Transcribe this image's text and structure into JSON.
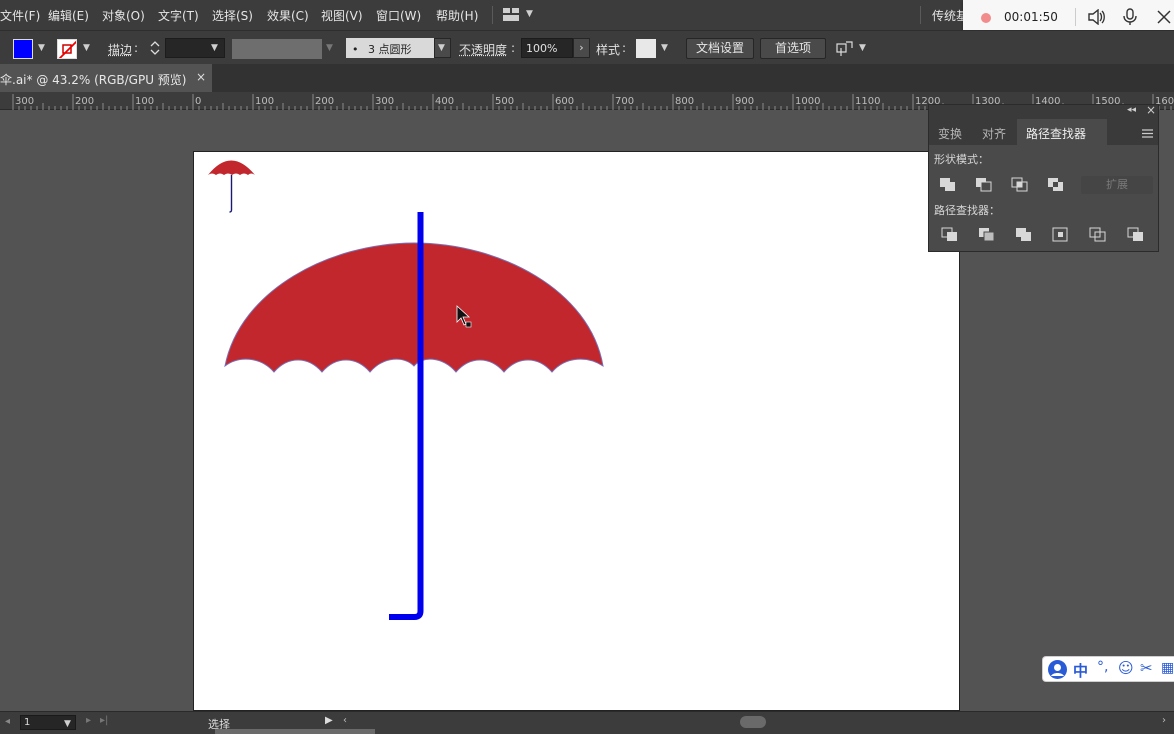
{
  "menu": {
    "items": [
      "文件(F)",
      "编辑(E)",
      "对象(O)",
      "文字(T)",
      "选择(S)",
      "效果(C)",
      "视图(V)",
      "窗口(W)",
      "帮助(H)"
    ],
    "workspace_label": "传统基"
  },
  "recorder": {
    "time": "00:01:50"
  },
  "control": {
    "stroke_label": "描边",
    "brush_value": "3 点圆形",
    "opacity_label": "不透明度",
    "opacity_value": "100%",
    "style_label": "样式",
    "doc_setup_button": "文档设置",
    "prefs_button": "首选项"
  },
  "document": {
    "tab_title": "伞.ai* @ 43.2% (RGB/GPU 预览)",
    "close_glyph": "×"
  },
  "ruler": {
    "ticks": [
      "300",
      "200",
      "100",
      "0",
      "100",
      "200",
      "300",
      "400",
      "500",
      "600",
      "700",
      "800",
      "900",
      "1000",
      "1100",
      "1200",
      "1300",
      "1400",
      "1500",
      "1600"
    ]
  },
  "panel": {
    "tabs": [
      "变换",
      "对齐",
      "路径查找器"
    ],
    "shape_modes_label": "形状模式：",
    "expand_button": "扩展",
    "pathfinders_label": "路径查找器："
  },
  "status": {
    "page_value": "1",
    "status_text": "选择"
  },
  "ime": {
    "zh_label": "中"
  },
  "colors": {
    "fill": "#0000ff",
    "umbrella_red": "#c1272d",
    "handle_blue": "#0000ee"
  }
}
